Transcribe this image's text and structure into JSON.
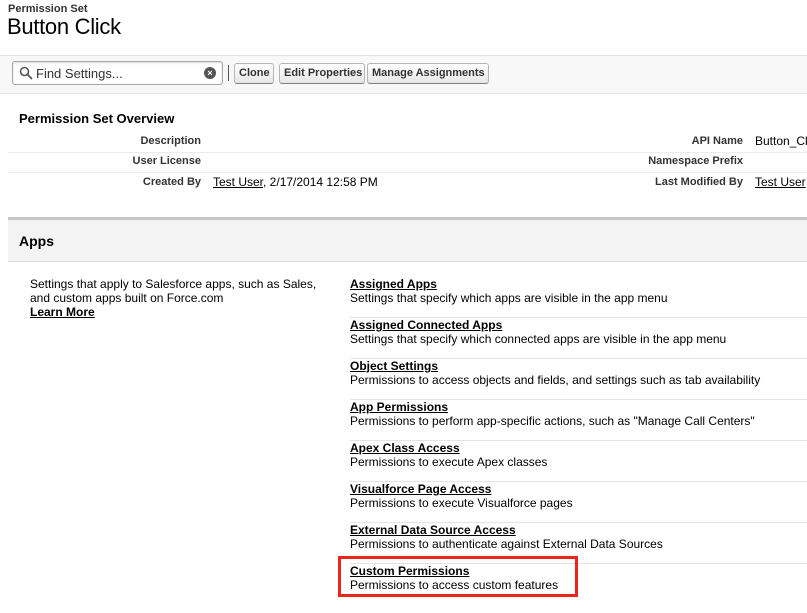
{
  "header": {
    "kicker": "Permission Set",
    "title": "Button Click"
  },
  "toolbar": {
    "search_placeholder": "Find Settings...",
    "search_value": "",
    "clear_label": "×",
    "clone_label": "Clone",
    "edit_label": "Edit Properties",
    "manage_label": "Manage Assignments"
  },
  "overview": {
    "title": "Permission Set Overview",
    "rows": [
      {
        "left_label": "Description",
        "left_value": "",
        "right_label": "API Name",
        "right_value": "Button_Cl"
      },
      {
        "left_label": "User License",
        "left_value": "",
        "right_label": "Namespace Prefix",
        "right_value": ""
      },
      {
        "left_label": "Created By",
        "left_value_link": "Test User",
        "left_value_rest": ", 2/17/2014 12:58 PM",
        "right_label": "Last Modified By",
        "right_value_link": "Test User"
      }
    ]
  },
  "apps": {
    "title": "Apps",
    "description": "Settings that apply to Salesforce apps, such as Sales, and custom apps built on Force.com",
    "learn_more": "Learn More",
    "items": [
      {
        "name": "Assigned Apps",
        "desc": "Settings that specify which apps are visible in the app menu"
      },
      {
        "name": "Assigned Connected Apps",
        "desc": "Settings that specify which connected apps are visible in the app menu"
      },
      {
        "name": "Object Settings",
        "desc": "Permissions to access objects and fields, and settings such as tab availability"
      },
      {
        "name": "App Permissions",
        "desc": "Permissions to perform app-specific actions, such as \"Manage Call Centers\""
      },
      {
        "name": "Apex Class Access",
        "desc": "Permissions to execute Apex classes"
      },
      {
        "name": "Visualforce Page Access",
        "desc": "Permissions to execute Visualforce pages"
      },
      {
        "name": "External Data Source Access",
        "desc": "Permissions to authenticate against External Data Sources"
      },
      {
        "name": "Custom Permissions",
        "desc": "Permissions to access custom features"
      }
    ]
  },
  "colors": {
    "highlight": "#e8261e",
    "header_band": "#f3f3f3"
  }
}
